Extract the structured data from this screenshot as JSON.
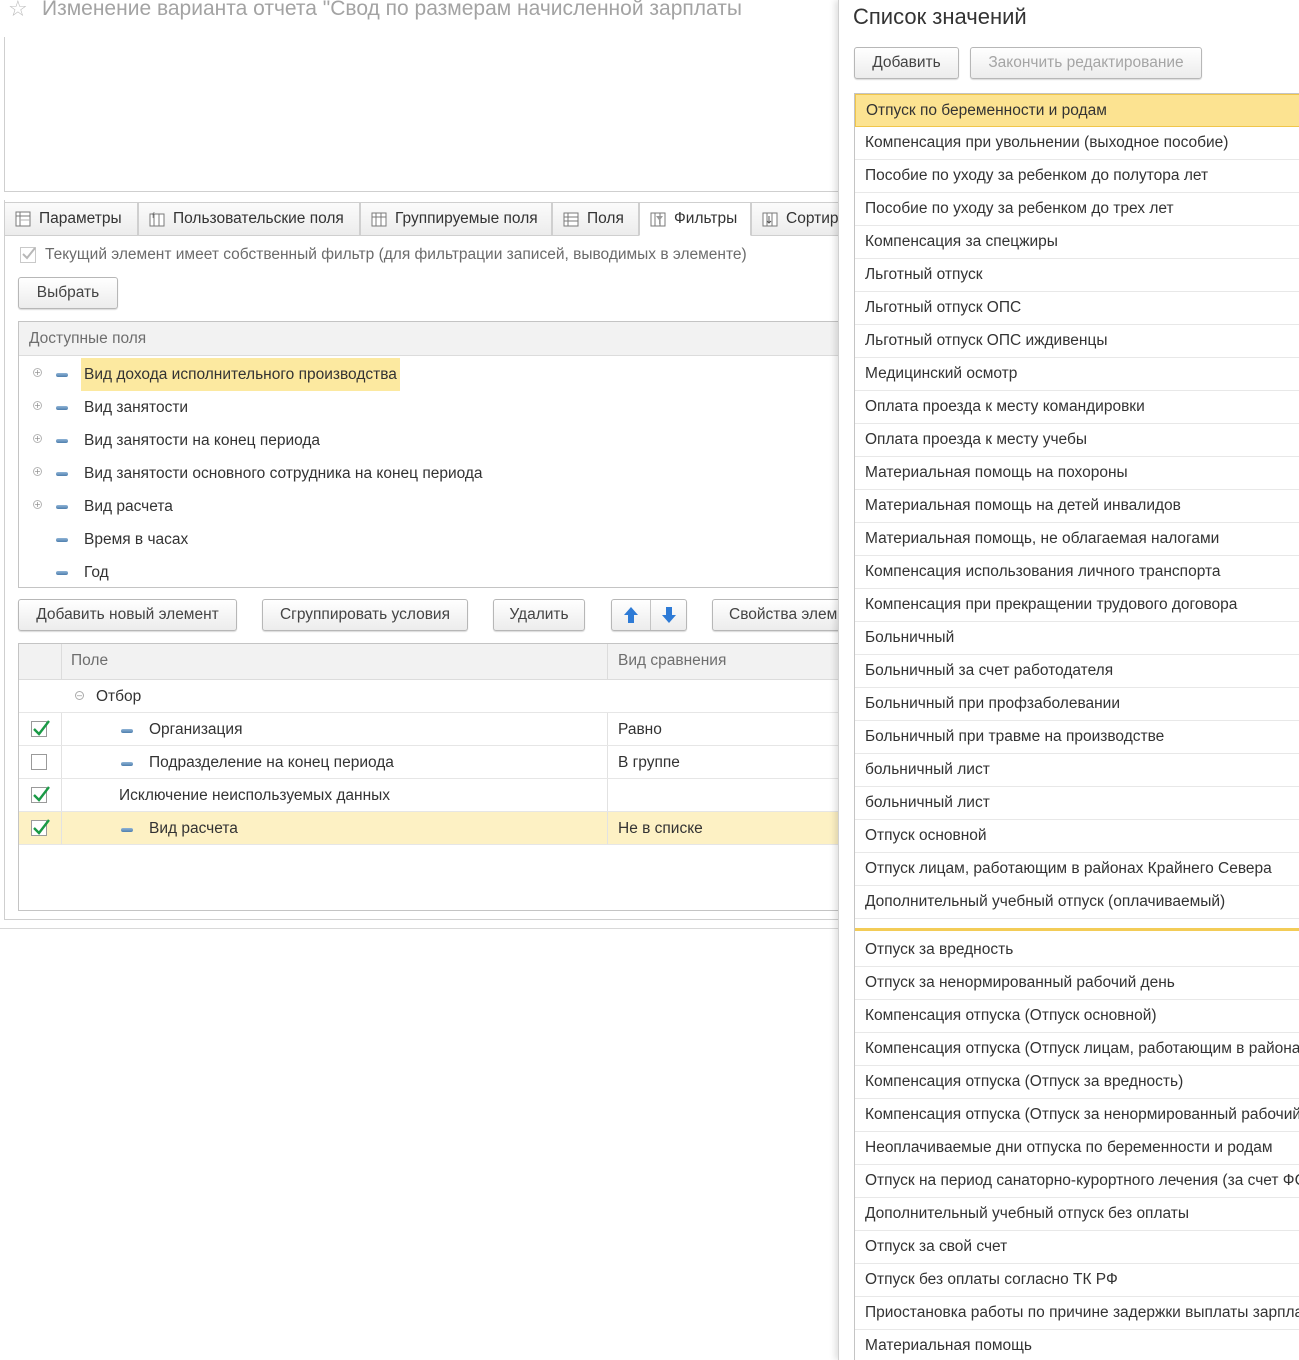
{
  "window": {
    "title": "Изменение варианта отчета \"Свод по размерам начисленной зарплаты"
  },
  "tabs": [
    {
      "label": "Параметры",
      "icon": "parameters-icon"
    },
    {
      "label": "Пользовательские поля",
      "icon": "custom-fields-icon"
    },
    {
      "label": "Группируемые поля",
      "icon": "grouping-fields-icon"
    },
    {
      "label": "Поля",
      "icon": "fields-icon"
    },
    {
      "label": "Фильтры",
      "icon": "filter-icon",
      "active": true
    },
    {
      "label": "Сортир",
      "icon": "sort-icon"
    }
  ],
  "own_filter_label": "Текущий элемент имеет собственный фильтр (для фильтрации записей, выводимых в элементе)",
  "buttons": {
    "select": "Выбрать",
    "add_new": "Добавить новый элемент",
    "group_conditions": "Сгруппировать условия",
    "delete": "Удалить",
    "properties": "Свойства элем"
  },
  "available_fields": {
    "header": "Доступные поля",
    "items": [
      {
        "label": "Вид дохода исполнительного производства",
        "expandable": true,
        "highlighted": true
      },
      {
        "label": "Вид занятости",
        "expandable": true
      },
      {
        "label": "Вид занятости на конец периода",
        "expandable": true
      },
      {
        "label": "Вид занятости основного сотрудника на конец периода",
        "expandable": true
      },
      {
        "label": "Вид расчета",
        "expandable": true
      },
      {
        "label": "Время в часах",
        "expandable": false
      },
      {
        "label": "Год",
        "expandable": false
      }
    ]
  },
  "filter_grid": {
    "headers": {
      "field": "Поле",
      "comparison": "Вид сравнения"
    },
    "group_label": "Отбор",
    "rows": [
      {
        "checked": true,
        "field": "Организация",
        "comparison": "Равно",
        "icon": true
      },
      {
        "checked": false,
        "field": "Подразделение на конец периода",
        "comparison": "В группе",
        "icon": true
      },
      {
        "checked": true,
        "field": "Исключение неиспользуемых данных",
        "comparison": "",
        "icon": false
      },
      {
        "checked": true,
        "field": "Вид расчета",
        "comparison": "Не в списке",
        "icon": true,
        "selected": true
      }
    ]
  },
  "value_list": {
    "title": "Список значений",
    "add_button": "Добавить",
    "finish_button": "Закончить редактирование",
    "items_top": [
      "Отпуск по беременности и родам",
      "Компенсация при увольнении (выходное пособие)",
      "Пособие по уходу за ребенком до полутора лет",
      "Пособие по уходу за ребенком до трех лет",
      "Компенсация за спецжиры",
      "Льготный отпуск",
      "Льготный отпуск ОПС",
      "Льготный отпуск ОПС иждивенцы",
      "Медицинский осмотр",
      "Оплата проезда к месту командировки",
      "Оплата проезда к месту учебы",
      "Материальная помощь на похороны",
      "Материальная помощь на детей инвалидов",
      "Материальная помощь, не облагаемая налогами",
      "Компенсация использования личного транспорта",
      "Компенсация при прекращении трудового договора",
      "Больничный",
      "Больничный за счет работодателя",
      "Больничный при профзаболевании",
      "Больничный при травме на производстве",
      "больничный лист",
      "больничный лист",
      "Отпуск основной",
      "Отпуск лицам, работающим в районах Крайнего Севера",
      "Дополнительный учебный отпуск (оплачиваемый)"
    ],
    "items_bottom": [
      "Отпуск за вредность",
      "Отпуск за ненормированный рабочий день",
      "Компенсация отпуска (Отпуск основной)",
      "Компенсация отпуска (Отпуск лицам, работающим в района",
      "Компенсация отпуска (Отпуск за вредность)",
      "Компенсация отпуска (Отпуск за ненормированный рабочий",
      "Неоплачиваемые дни отпуска по беременности и родам",
      "Отпуск на период санаторно-курортного лечения (за счет ФС",
      "Дополнительный учебный отпуск без оплаты",
      "Отпуск за свой счет",
      "Отпуск без оплаты согласно ТК РФ",
      "Приостановка работы по причине задержки выплаты зарпла",
      "Материальная помощь"
    ]
  },
  "colors": {
    "selection": "#fce391",
    "highlight": "#fce9a0",
    "check_green": "#1a9a46",
    "arrow_blue": "#2e7bd6"
  }
}
